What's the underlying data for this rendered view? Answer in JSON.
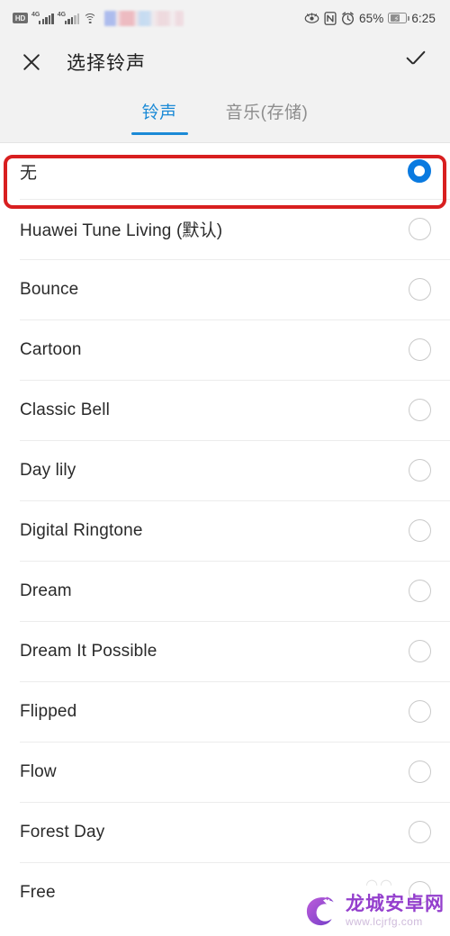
{
  "status_bar": {
    "hd_badge": "HD",
    "network_1": "4G",
    "network_2": "4G",
    "wifi_icon": "wifi-icon",
    "censored_region": "blurred-carrier-name",
    "eye_icon": "eye-off-icon",
    "nfc_icon": "nfc-icon",
    "alarm_icon": "alarm-clock-icon",
    "battery_percent": "65%",
    "battery_icon": "battery-charging-icon",
    "time": "6:25"
  },
  "title_bar": {
    "close_icon": "close-icon",
    "title": "选择铃声",
    "confirm_icon": "check-icon"
  },
  "tabs": [
    {
      "label": "铃声",
      "active": true
    },
    {
      "label": "音乐(存储)",
      "active": false
    }
  ],
  "colors": {
    "accent": "#1b8ad6",
    "radio_selected": "#0a7ae0",
    "annotation": "#d81f20",
    "chrome_bg": "#f2f2f2",
    "list_bg": "#ffffff",
    "divider": "#ececec",
    "watermark": "#8b2fc9"
  },
  "ringtone_list": [
    {
      "label": "无",
      "selected": true,
      "highlighted": true
    },
    {
      "label": "Huawei Tune Living (默认)",
      "selected": false
    },
    {
      "label": "Bounce",
      "selected": false
    },
    {
      "label": "Cartoon",
      "selected": false
    },
    {
      "label": "Classic Bell",
      "selected": false
    },
    {
      "label": "Day lily",
      "selected": false
    },
    {
      "label": "Digital Ringtone",
      "selected": false
    },
    {
      "label": "Dream",
      "selected": false
    },
    {
      "label": "Dream It Possible",
      "selected": false
    },
    {
      "label": "Flipped",
      "selected": false
    },
    {
      "label": "Flow",
      "selected": false
    },
    {
      "label": "Forest Day",
      "selected": false
    },
    {
      "label": "Free",
      "selected": false
    }
  ],
  "watermark": {
    "name": "龙城安卓网",
    "url": "www.lcjrfg.com"
  }
}
